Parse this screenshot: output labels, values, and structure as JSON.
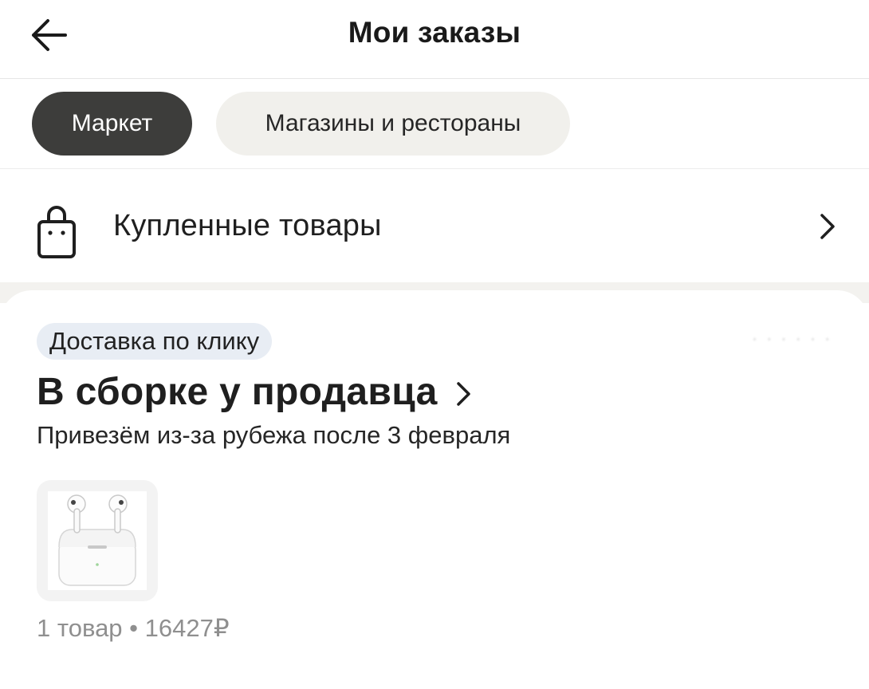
{
  "header": {
    "title": "Мои заказы",
    "back_icon": "arrow-left-icon"
  },
  "tabs": [
    {
      "label": "Маркет",
      "active": true
    },
    {
      "label": "Магазины и рестораны",
      "active": false
    }
  ],
  "purchased": {
    "label": "Купленные товары",
    "icon": "shopping-bag-icon"
  },
  "order": {
    "badge": "Доставка по клику",
    "status": "В сборке у продавца",
    "subtitle": "Привезём из-за рубежа после 3 февраля",
    "product_image": "airpods-pro-case-image",
    "summary": "1 товар • 16427₽"
  },
  "colors": {
    "active_tab_bg": "#3d3d3b",
    "inactive_tab_bg": "#f1f0ec",
    "badge_bg": "#e8edf4",
    "muted_text": "#8f8f8f"
  }
}
